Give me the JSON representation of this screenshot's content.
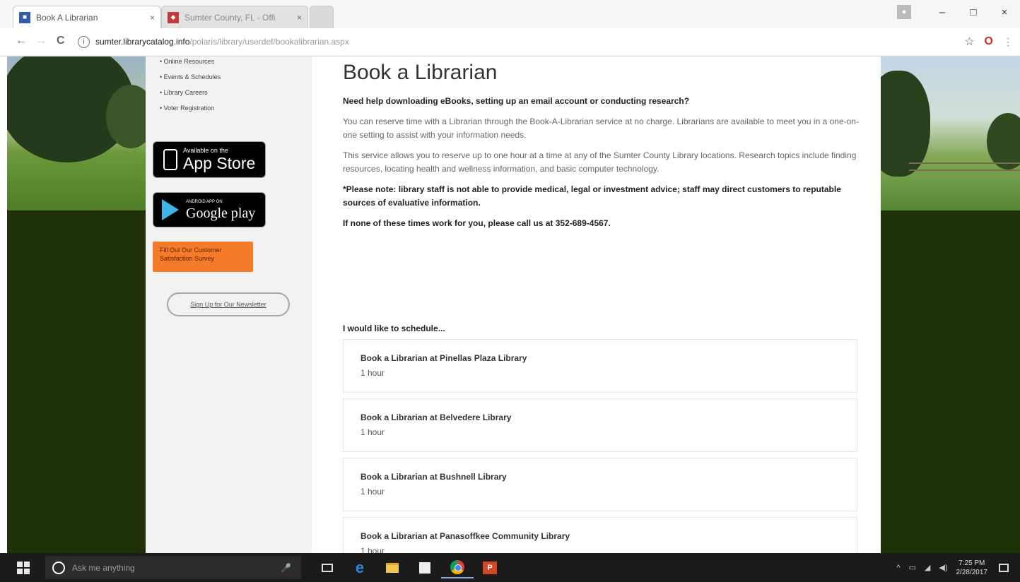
{
  "browser": {
    "tabs": [
      {
        "title": "Book A Librarian",
        "favicon": "library-favicon",
        "active": true
      },
      {
        "title": "Sumter County, FL - Offi",
        "favicon": "county-favicon",
        "active": false
      }
    ],
    "tab_close": "×",
    "nav": {
      "back": "←",
      "forward": "→",
      "reload": "C"
    },
    "address": {
      "info_icon": "i",
      "domain": "sumter.librarycatalog.info",
      "path": "/polaris/library/userdef/bookalibrarian.aspx"
    },
    "toolbar_icons": {
      "bookmark": "☆",
      "opera": "O",
      "menu": "⋮"
    },
    "window_controls": {
      "minimize": "–",
      "maximize": "□",
      "close": "×"
    }
  },
  "sidebar": {
    "links": [
      "Online Resources",
      "Events & Schedules",
      "Library Careers",
      "Voter Registration"
    ],
    "app_store": {
      "small": "Available on the",
      "big": "App Store"
    },
    "google_play": {
      "small": "ANDROID APP ON",
      "big": "Google play"
    },
    "survey_label": "Fill Out Our Customer Satisfaction Survey",
    "newsletter_label": "Sign Up for Our Newsletter"
  },
  "main": {
    "title": "Book a Librarian",
    "intro_question": "Need help downloading eBooks, setting up an email account or conducting research?",
    "para1": "You can reserve time with a Librarian through the Book-A-Librarian service at no charge. Librarians are available to meet you in a one-on-one setting to assist with your information needs.",
    "para2": "This service allows you to reserve up to one hour at a time at any of the Sumter County Library locations. Research topics include finding resources, locating health and wellness information, and basic computer technology.",
    "note": "*Please note: library staff is not able to provide medical, legal or investment advice; staff may direct customers to reputable sources of evaluative information.",
    "call": "If none of these times work for you, please call us at 352-689-4567.",
    "schedule_label": "I would like to schedule...",
    "services": [
      {
        "name": "Book a Librarian at Pinellas Plaza Library",
        "duration": "1 hour"
      },
      {
        "name": "Book a Librarian at Belvedere Library",
        "duration": "1 hour"
      },
      {
        "name": "Book a Librarian at Bushnell Library",
        "duration": "1 hour"
      },
      {
        "name": "Book a Librarian at Panasoffkee Community Library",
        "duration": "1 hour"
      }
    ]
  },
  "taskbar": {
    "search_placeholder": "Ask me anything",
    "tray": {
      "chevron": "^",
      "network": "▭",
      "wifi": "◢",
      "volume": "◀)"
    },
    "clock_time": "7:25 PM",
    "clock_date": "2/28/2017",
    "ppt_label": "P"
  }
}
